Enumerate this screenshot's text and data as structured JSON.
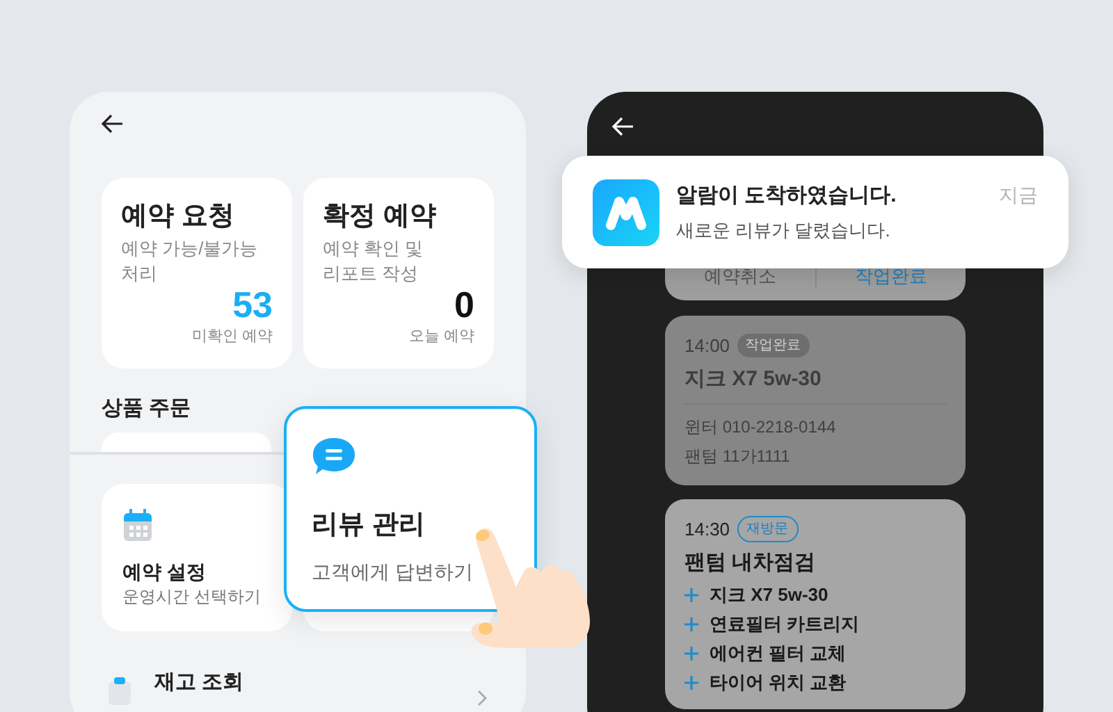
{
  "left_screen": {
    "stat_cards": [
      {
        "title": "예약 요청",
        "description": "예약 가능/불가능 처리",
        "count": "53",
        "count_label": "미확인 예약",
        "highlighted": true
      },
      {
        "title": "확정 예약",
        "description": "예약 확인 및 리포트 작성",
        "count": "0",
        "count_label": "오늘 예약",
        "highlighted": false
      }
    ],
    "section_title": "상품 주문",
    "menu_card": {
      "title": "예약 설정",
      "subtitle": "운영시간 선택하기"
    },
    "list_item": {
      "label": "재고 조회"
    }
  },
  "popup_card": {
    "title": "리뷰 관리",
    "subtitle": "고객에게 답변하기"
  },
  "right_screen": {
    "action_buttons": [
      {
        "label": "예약취소",
        "kind": "cancel"
      },
      {
        "label": "작업완료",
        "kind": "complete"
      }
    ],
    "bookings": [
      {
        "time": "14:00",
        "badge": "작업완료",
        "title": "지크 X7 5w-30",
        "details": [
          "윈터 010-2218-0144",
          "팬텀 11가1111"
        ],
        "done": true
      },
      {
        "time": "14:30",
        "badge": "재방문",
        "title": "팬텀 내차점검",
        "items": [
          "지크 X7 5w-30",
          "연료필터 카트리지",
          "에어컨 필터 교체",
          "타이어 위치 교환"
        ],
        "done": false
      }
    ]
  },
  "notification": {
    "title": "알람이 도착하였습니다.",
    "body": "새로운 리뷰가 달렸습니다.",
    "time": "지금"
  }
}
